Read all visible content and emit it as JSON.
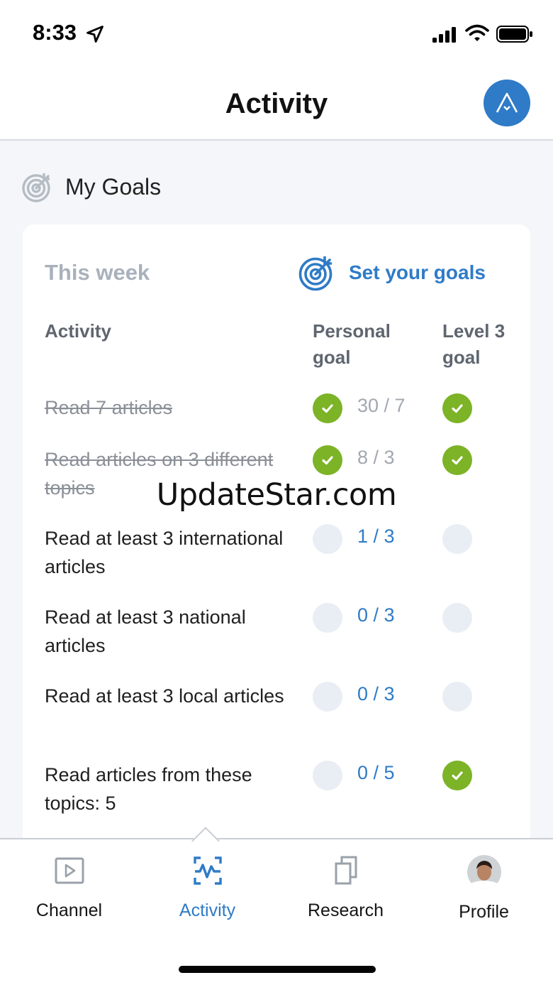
{
  "status_bar": {
    "time": "8:33",
    "icons": [
      "location-arrow-icon",
      "cellular-signal-icon",
      "wifi-icon",
      "battery-icon"
    ]
  },
  "header": {
    "title": "Activity",
    "account_icon": "account-logo-icon"
  },
  "goals_section": {
    "heading": "My Goals",
    "heading_icon": "target-icon"
  },
  "card": {
    "period_label": "This week",
    "set_goals_label": "Set your goals",
    "columns": {
      "activity": "Activity",
      "personal": "Personal goal",
      "level": "Level 3 goal"
    },
    "rows": [
      {
        "label": "Read 7 articles",
        "progress": "30 / 7",
        "personal_done": true,
        "level_done": true,
        "completed": true
      },
      {
        "label": "Read articles on 3 different topics",
        "progress": "8 / 3",
        "personal_done": true,
        "level_done": true,
        "completed": true
      },
      {
        "label": "Read at least 3 international articles",
        "progress": "1 / 3",
        "personal_done": false,
        "level_done": false,
        "completed": false
      },
      {
        "label": "Read at least 3 national articles",
        "progress": "0 / 3",
        "personal_done": false,
        "level_done": false,
        "completed": false
      },
      {
        "label": "Read at least 3 local articles",
        "progress": "0 / 3",
        "personal_done": false,
        "level_done": false,
        "completed": false
      },
      {
        "label": "Read articles from these topics: 5",
        "progress": "0 / 5",
        "personal_done": false,
        "level_done": true,
        "completed": false
      }
    ]
  },
  "watermark": "UpdateStar.com",
  "tab_bar": {
    "active": "Activity",
    "tabs": [
      {
        "label": "Channel",
        "icon": "play-video-icon"
      },
      {
        "label": "Activity",
        "icon": "activity-pulse-icon"
      },
      {
        "label": "Research",
        "icon": "copy-pages-icon"
      },
      {
        "label": "Profile",
        "icon": "avatar"
      }
    ]
  },
  "colors": {
    "accent": "#2f7bc7",
    "success": "#7cb327",
    "muted": "#a9b1bb",
    "background": "#f4f6f9"
  }
}
